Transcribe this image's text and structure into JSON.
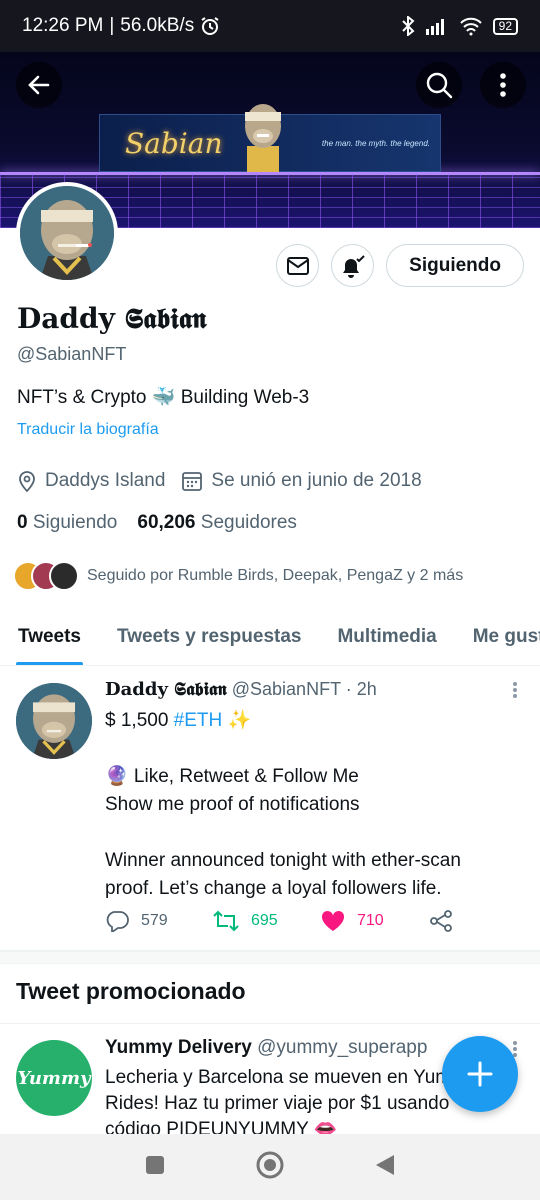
{
  "status_bar": {
    "time": "12:26 PM",
    "speed": "56.0kB/s",
    "battery": "92"
  },
  "banner": {
    "sign_text": "Sabian",
    "tagline": "the man. the myth. the legend."
  },
  "profile": {
    "display_name": "Daddy 𝕾𝖆𝖇𝖎𝖆𝖓",
    "handle": "@SabianNFT",
    "bio": "NFT’s & Crypto 🐳 Building Web-3",
    "translate_bio": "Traducir la biografía",
    "location": "Daddys Island",
    "joined": "Se unió en junio de 2018",
    "following_count": "0",
    "following_label": "Siguiendo",
    "followers_count": "60,206",
    "followers_label": "Seguidores",
    "followed_by": "Seguido por Rumble Birds, Deepak, PengaZ y 2 más",
    "follow_button": "Siguiendo"
  },
  "tabs": [
    {
      "label": "Tweets",
      "active": true
    },
    {
      "label": "Tweets y respuestas",
      "active": false
    },
    {
      "label": "Multimedia",
      "active": false
    },
    {
      "label": "Me gusta",
      "active": false
    }
  ],
  "tweet": {
    "name": "Daddy 𝕾𝖆𝖇𝖎𝖆𝖓",
    "handle_time": "@SabianNFT · 2h",
    "line1_prefix": "$ 1,500 ",
    "line1_hashtag": "#ETH",
    "line1_suffix": " ✨",
    "line2": "🔮 Like, Retweet & Follow Me",
    "line3": "Show me proof of notifications",
    "line4": "Winner announced tonight with ether-scan",
    "line5": "proof. Let’s change a loyal followers life.",
    "replies": "579",
    "retweets": "695",
    "likes": "710"
  },
  "promo": {
    "section_title": "Tweet promocionado",
    "avatar_text": "Yummy",
    "name": "Yummy Delivery",
    "handle": "@yummy_superapp",
    "line1": "Lecheria y Barcelona se mueven en Yummy",
    "line2": "Rides! Haz tu primer viaje por $1 usando",
    "line3": "código PIDEUNYUMMY 👄"
  },
  "colors": {
    "accent": "#1d9bf0",
    "retweet": "#00ba7c",
    "like": "#f91880"
  }
}
